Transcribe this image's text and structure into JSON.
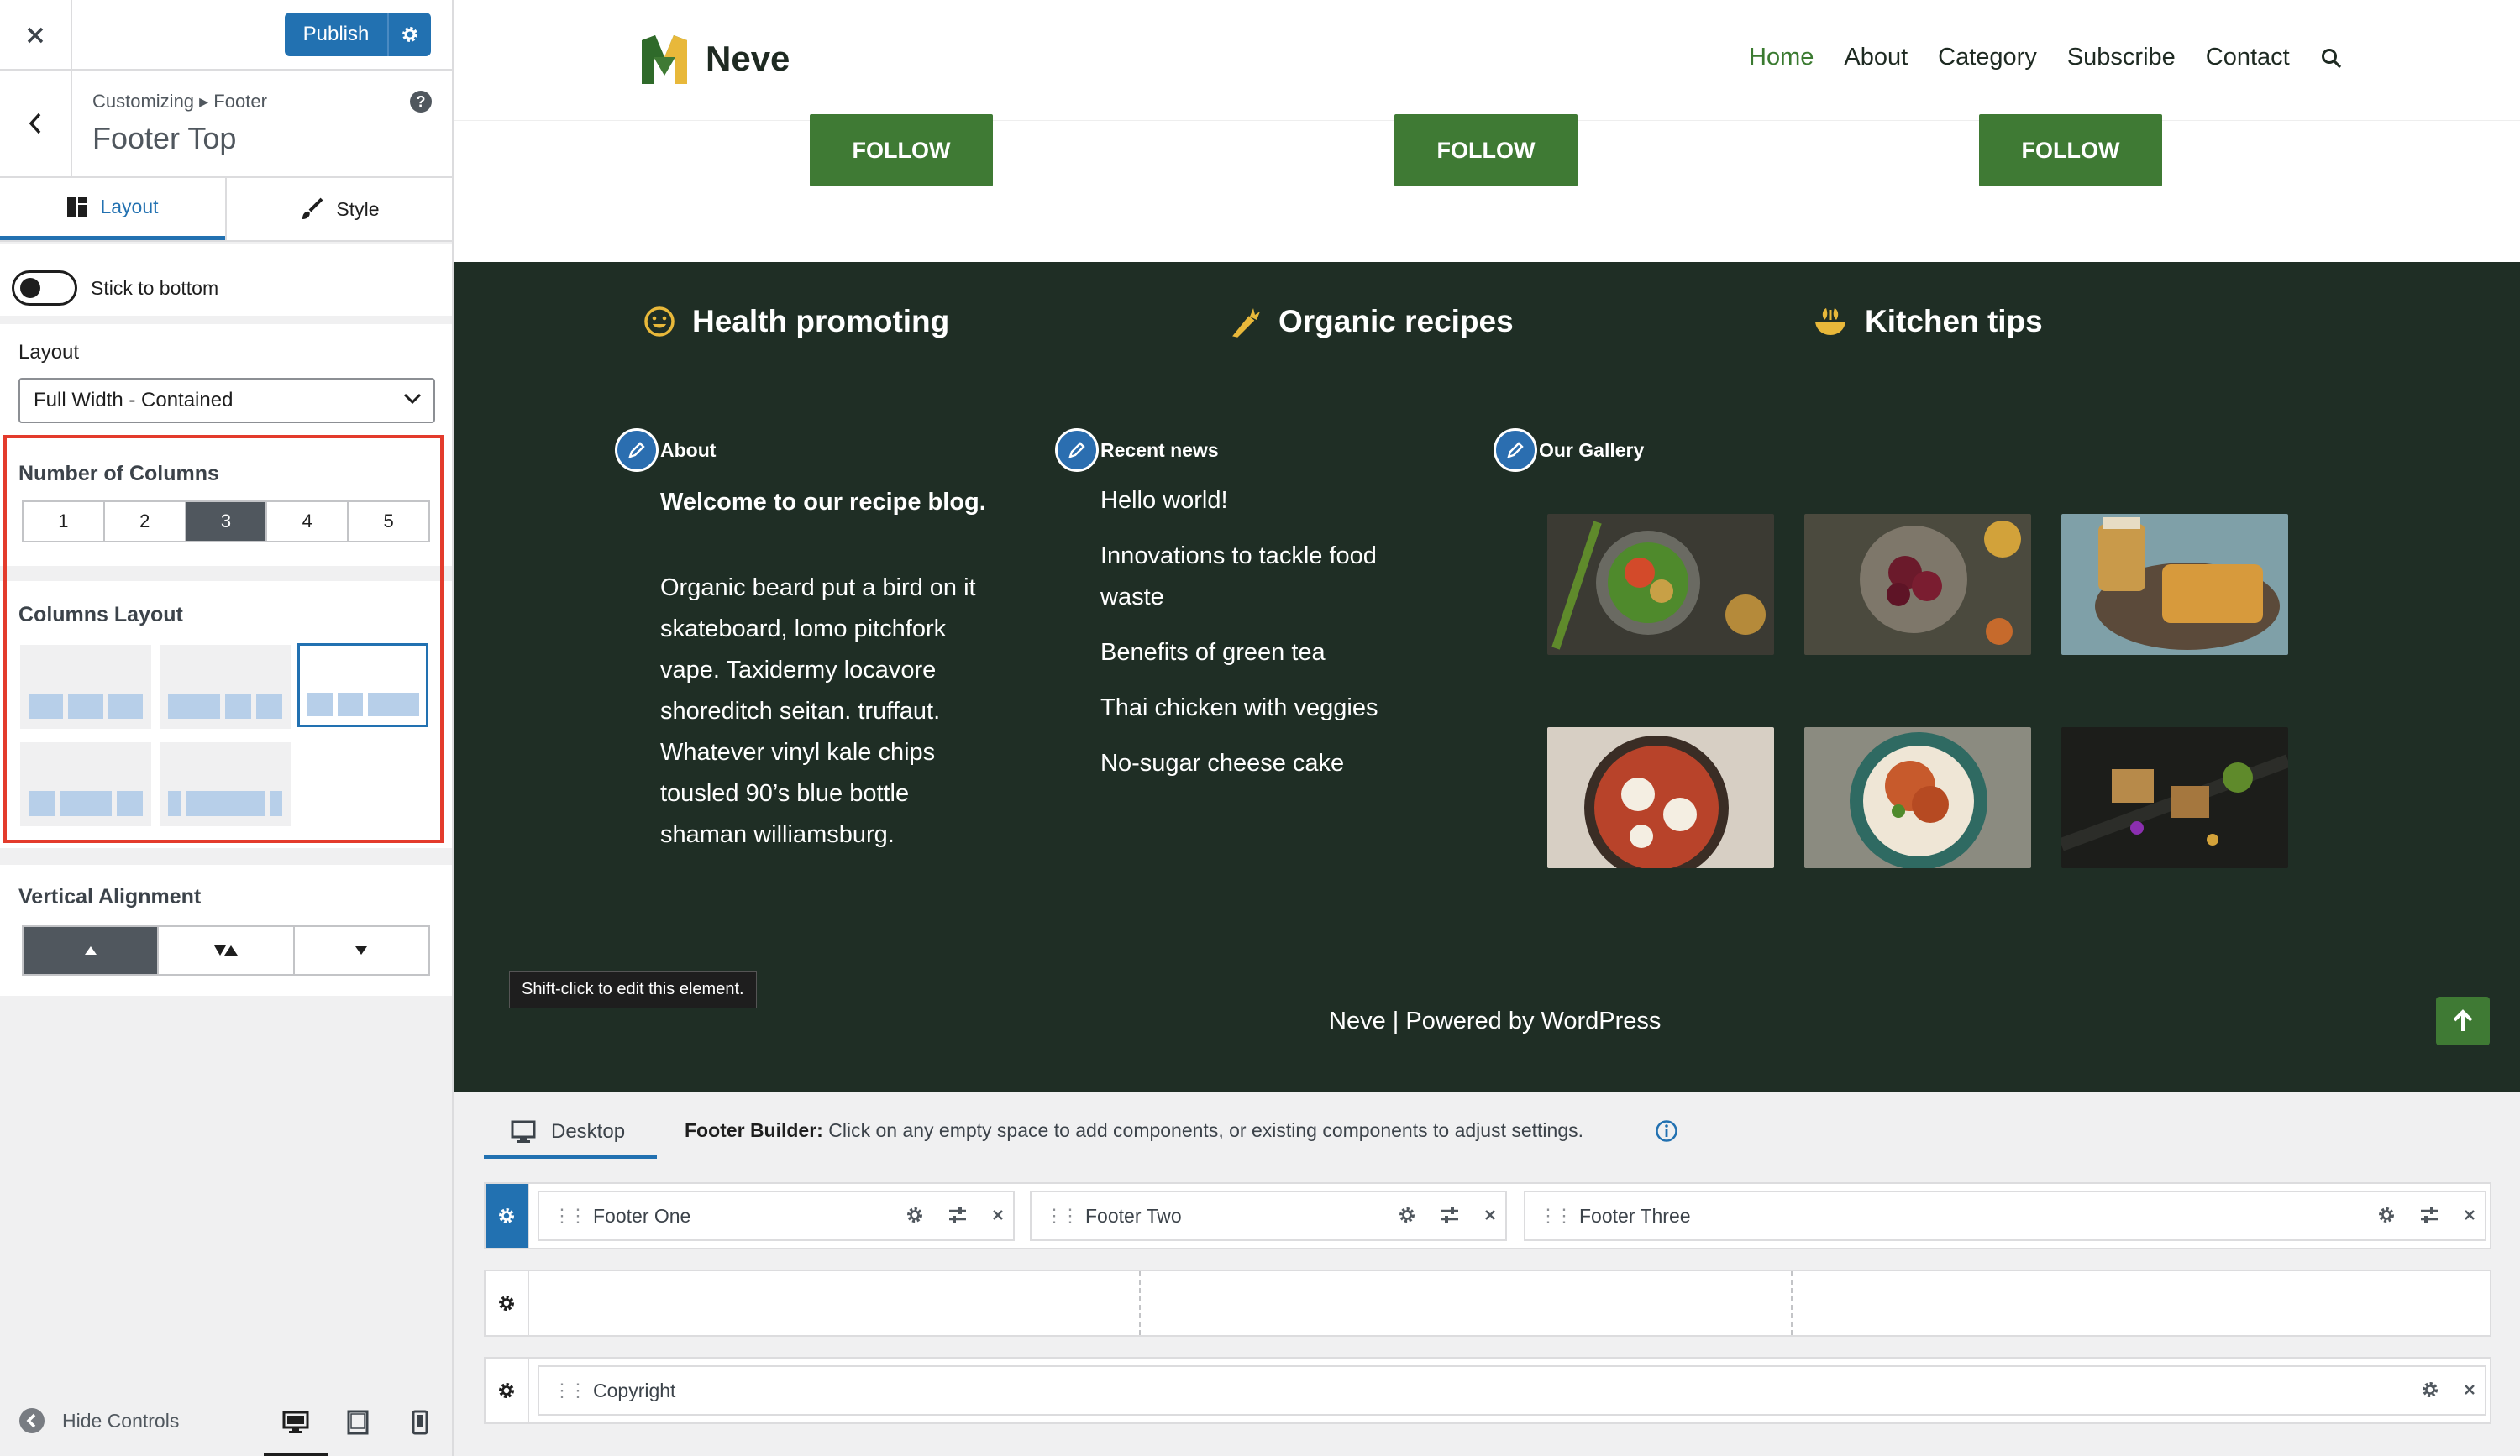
{
  "sidebar": {
    "publish_label": "Publish",
    "breadcrumb": "Customizing ▸ Footer",
    "section_title": "Footer Top",
    "tabs": [
      {
        "label": "Layout",
        "active": true
      },
      {
        "label": "Style",
        "active": false
      }
    ],
    "stick_to_bottom_label": "Stick to bottom",
    "stick_to_bottom_on": false,
    "layout_label": "Layout",
    "layout_value": "Full Width - Contained",
    "number_of_columns_label": "Number of Columns",
    "column_options": [
      "1",
      "2",
      "3",
      "4",
      "5"
    ],
    "selected_columns": "3",
    "columns_layout_label": "Columns Layout",
    "vertical_alignment_label": "Vertical Alignment",
    "hide_controls_label": "Hide Controls"
  },
  "preview": {
    "site_name": "Neve",
    "nav": [
      "Home",
      "About",
      "Category",
      "Subscribe",
      "Contact"
    ],
    "follow_label": "FOLLOW",
    "features": [
      "Health promoting",
      "Organic recipes",
      "Kitchen tips"
    ],
    "widgets": {
      "about_title": "About",
      "about_heading": "Welcome to our recipe blog.",
      "about_body": "Organic beard put a bird on it skateboard, lomo pitchfork vape. Taxidermy locavore shoreditch seitan. truffaut. Whatever vinyl kale chips tousled 90’s blue bottle shaman williamsburg.",
      "news_title": "Recent news",
      "news_items": [
        "Hello world!",
        "Innovations to tackle food waste",
        "Benefits of green tea",
        "Thai chicken with veggies",
        "No-sugar cheese cake"
      ],
      "gallery_title": "Our Gallery"
    },
    "tooltip": "Shift-click to edit this element.",
    "powered_by": "Neve | Powered by WordPress",
    "colors": {
      "accent_green": "#3f7a34",
      "footer_bg": "#1f2e25",
      "wp_blue": "#2271b1"
    }
  },
  "builder": {
    "device_tab": "Desktop",
    "info_label": "Footer Builder:",
    "info_text": "Click on any empty space to add components, or existing components to adjust settings.",
    "components": [
      "Footer One",
      "Footer Two",
      "Footer Three"
    ],
    "copyright": "Copyright"
  }
}
